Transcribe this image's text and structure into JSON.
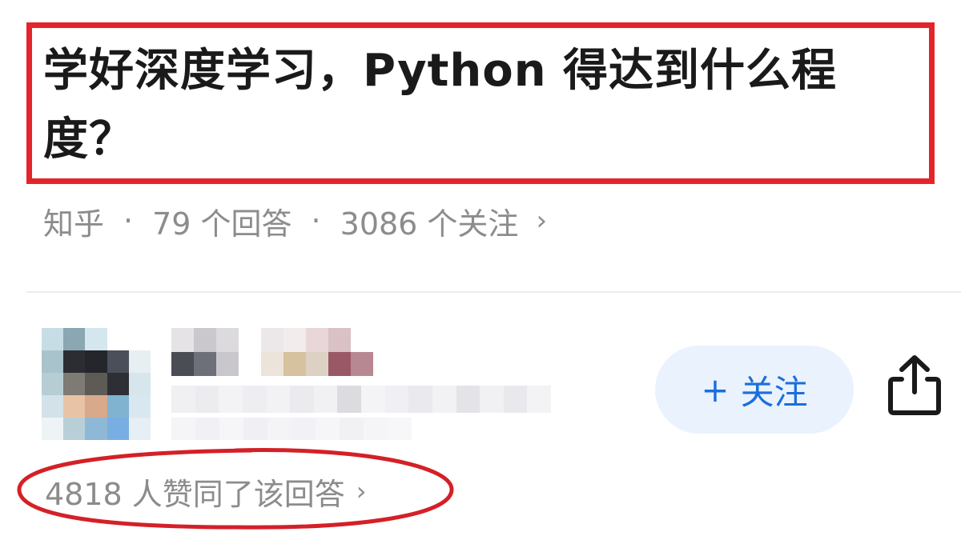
{
  "question": {
    "title": "学好深度学习，Python 得达到什么程度？"
  },
  "meta": {
    "source": "知乎",
    "separator": "·",
    "answers": "79 个回答",
    "followers": "3086 个关注",
    "chevron": "›"
  },
  "follow_button": {
    "plus": "+",
    "label": "关注"
  },
  "votes": {
    "text": "4818 人赞同了该回答",
    "chevron": "›"
  },
  "colors": {
    "highlight": "#e4242b",
    "accent": "#1a6fdc",
    "follow_bg": "#eaf2fd",
    "muted_text": "#8c8c8c"
  },
  "icons": {
    "share": "share-icon",
    "chevron": "chevron-right-icon"
  }
}
